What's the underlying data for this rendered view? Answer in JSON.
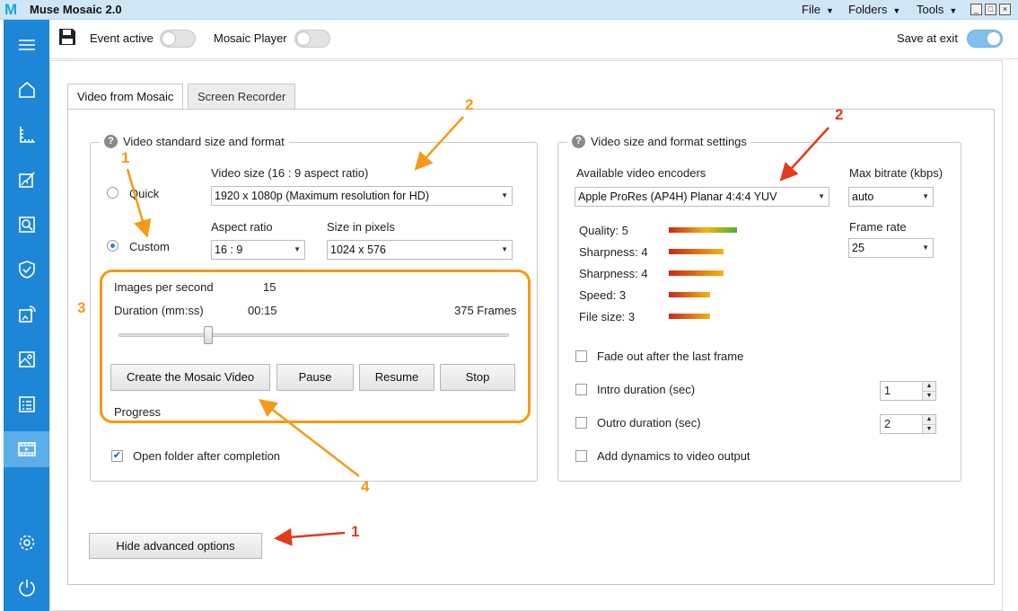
{
  "app": {
    "logo": "M",
    "title": "Muse Mosaic 2.0",
    "menus": [
      {
        "label": "File"
      },
      {
        "label": "Folders"
      },
      {
        "label": "Tools"
      }
    ],
    "window_controls": {
      "minimize": "_",
      "maximize": "□",
      "close": "×"
    }
  },
  "sidebar": {
    "items": [
      {
        "icon": "menu-icon"
      },
      {
        "icon": "home-icon"
      },
      {
        "icon": "ruler-icon"
      },
      {
        "icon": "edit-image-icon"
      },
      {
        "icon": "search-image-icon"
      },
      {
        "icon": "shield-icon"
      },
      {
        "icon": "cast-icon"
      },
      {
        "icon": "photo-icon"
      },
      {
        "icon": "list-icon"
      },
      {
        "icon": "video-icon",
        "active": true
      },
      {
        "icon": "settings-icon"
      },
      {
        "icon": "power-icon"
      }
    ]
  },
  "toolbar": {
    "event_active_label": "Event active",
    "event_active_on": false,
    "mosaic_player_label": "Mosaic Player",
    "mosaic_player_on": false,
    "save_at_exit_label": "Save at exit",
    "save_at_exit_on": true
  },
  "tabs": [
    {
      "label": "Video from Mosaic",
      "active": true
    },
    {
      "label": "Screen Recorder",
      "active": false
    }
  ],
  "left_group": {
    "title": "Video standard size and format",
    "video_size_label": "Video size (16 : 9 aspect ratio)",
    "quick_label": "Quick",
    "custom_label": "Custom",
    "selected_mode": "Custom",
    "video_size_value": "1920 x 1080p (Maximum resolution for HD)",
    "aspect_ratio_label": "Aspect ratio",
    "aspect_ratio_value": "16 : 9",
    "size_pixels_label": "Size in pixels",
    "size_pixels_value": "1024 x 576",
    "images_per_second_label": "Images per second",
    "images_per_second_value": "15",
    "duration_label": "Duration (mm:ss)",
    "duration_value": "00:15",
    "frames_value": "375 Frames",
    "slider_fraction": 0.23,
    "buttons": {
      "create": "Create the Mosaic Video",
      "pause": "Pause",
      "resume": "Resume",
      "stop": "Stop"
    },
    "progress_label": "Progress",
    "open_folder_label": "Open folder after completion",
    "open_folder_checked": true
  },
  "right_group": {
    "title": "Video size and format settings",
    "encoders_label": "Available video encoders",
    "encoder_value": "Apple ProRes (AP4H) Planar 4:4:4 YUV",
    "max_bitrate_label": "Max bitrate (kbps)",
    "max_bitrate_value": "auto",
    "frame_rate_label": "Frame rate",
    "frame_rate_value": "25",
    "metrics": [
      {
        "label": "Quality: 5",
        "value": 5
      },
      {
        "label": "Sharpness: 4",
        "value": 4
      },
      {
        "label": "Sharpness: 4",
        "value": 4
      },
      {
        "label": "Speed: 3",
        "value": 3
      },
      {
        "label": "File size: 3",
        "value": 3
      }
    ],
    "fade_out_label": "Fade out after the last frame",
    "intro_label": "Intro duration (sec)",
    "intro_value": "1",
    "outro_label": "Outro duration (sec)",
    "outro_value": "2",
    "dynamics_label": "Add dynamics to video output"
  },
  "hide_advanced_label": "Hide advanced options",
  "annotations": {
    "orange_color": "#f49a16",
    "red_color": "#e23a1d",
    "labels": [
      "1",
      "2",
      "3",
      "4",
      "2",
      "1"
    ]
  }
}
